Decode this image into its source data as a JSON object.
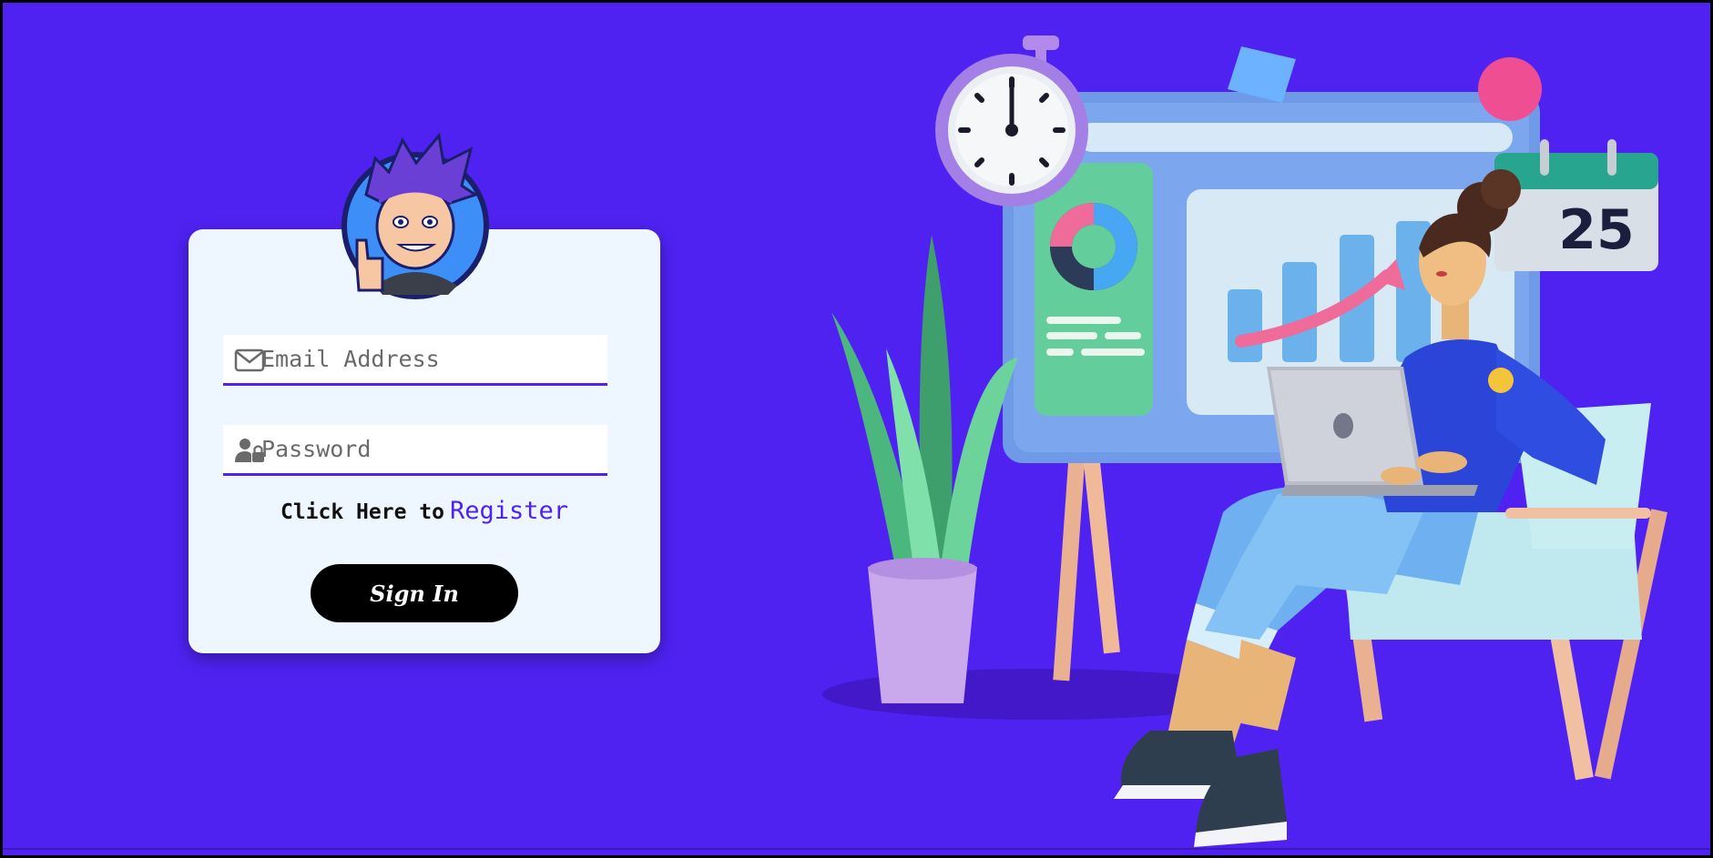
{
  "login": {
    "email_placeholder": "Email Address",
    "password_placeholder": "Password",
    "register_prefix": "Click Here to",
    "register_link": "Register",
    "signin_label": "Sign In"
  },
  "illustration": {
    "calendar_day": "25"
  },
  "icons": [
    "avatar-icon",
    "envelope-icon",
    "user-lock-icon"
  ],
  "colors": {
    "background": "#4f22f2",
    "card": "#eef6ff",
    "accent": "#4f22f2",
    "button": "#000000"
  }
}
